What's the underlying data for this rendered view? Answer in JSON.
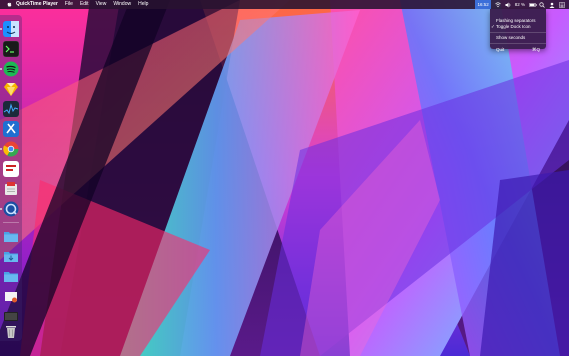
{
  "menubar": {
    "apple_icon": "apple-logo-icon",
    "app_name": "QuickTime Player",
    "menus": [
      "File",
      "Edit",
      "View",
      "Window",
      "Help"
    ],
    "status": {
      "active_item": "16:52",
      "battery_text": "82 %",
      "icons": [
        "wifi-icon",
        "volume-icon",
        "battery-icon",
        "search-icon",
        "user-icon",
        "notification-icon"
      ]
    }
  },
  "dropdown": {
    "items": [
      {
        "label": "Flashing separators",
        "checked": false
      },
      {
        "label": "Toggle Dock Icon",
        "checked": true,
        "check_mark": "✓"
      },
      {
        "label": "Show seconds",
        "checked": false
      },
      {
        "label": "Quit",
        "shortcut": "⌘Q"
      }
    ]
  },
  "dock": {
    "items": [
      {
        "name": "finder-icon",
        "color": "#1e90ff"
      },
      {
        "name": "terminal-icon",
        "color": "#1a1a1a"
      },
      {
        "name": "spotify-icon",
        "color": "#1db954"
      },
      {
        "name": "sketch-icon",
        "color": "#f7b500"
      },
      {
        "name": "activity-monitor-icon",
        "color": "#1c2a3a"
      },
      {
        "name": "xcode-icon",
        "color": "#1f6fd1"
      },
      {
        "name": "chrome-icon",
        "color": "#ea4335"
      },
      {
        "name": "speakerdeck-icon",
        "color": "#ffffff"
      },
      {
        "name": "flashcard-icon",
        "color": "#e8e8e8"
      },
      {
        "name": "quicktime-icon",
        "color": "#1b4fa3"
      },
      {
        "name": "folder-icon",
        "color": "#4aa3e6"
      },
      {
        "name": "downloads-folder-icon",
        "color": "#4aa3e6"
      },
      {
        "name": "folder-icon",
        "color": "#4aa3e6"
      },
      {
        "name": "document-icon",
        "color": "#f4f4f4"
      },
      {
        "name": "movie-icon",
        "color": "#222222"
      },
      {
        "name": "trash-icon",
        "color": "#c7c7c7"
      }
    ]
  },
  "colors": {
    "menubar_bg": "#281230",
    "highlight": "#3b6fd9",
    "wallpaper_base": "#2a0f4a"
  }
}
